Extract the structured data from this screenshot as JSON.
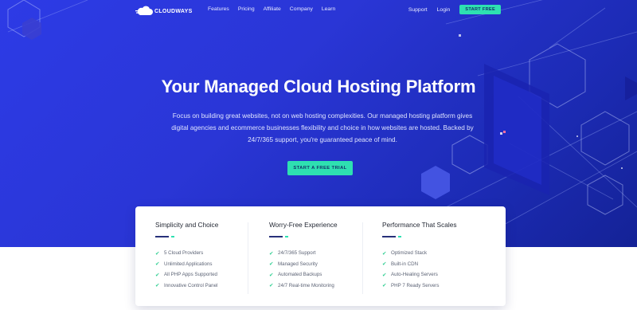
{
  "brand": {
    "name": "CLOUDWAYS"
  },
  "nav": {
    "links": [
      "Features",
      "Pricing",
      "Affiliate",
      "Company",
      "Learn"
    ],
    "support": "Support",
    "login": "Login",
    "start_free": "START FREE"
  },
  "hero": {
    "headline": "Your Managed Cloud Hosting Platform",
    "subtext": "Focus on building great websites, not on web hosting complexities. Our managed hosting platform gives digital agencies and ecommerce businesses flexibility and choice in how websites are hosted. Backed by 24/7/365 support, you're guaranteed peace of mind.",
    "cta": "START A FREE TRIAL"
  },
  "features": {
    "columns": [
      {
        "title": "Simplicity and Choice",
        "items": [
          "5 Cloud Providers",
          "Unlimited Applications",
          "All PHP Apps Supported",
          "Innovative Control Panel"
        ]
      },
      {
        "title": "Worry-Free Experience",
        "items": [
          "24/7/365 Support",
          "Managed Security",
          "Automated Backups",
          "24/7 Real-time Monitoring"
        ]
      },
      {
        "title": "Performance That Scales",
        "items": [
          "Optimized Stack",
          "Built-in CDN",
          "Auto-Healing Servers",
          "PHP 7 Ready Servers"
        ]
      }
    ]
  },
  "colors": {
    "hero_bg": "#2a36d6",
    "accent": "#2ee0b1",
    "check": "#2fcf92",
    "bar_dark": "#27307a"
  }
}
